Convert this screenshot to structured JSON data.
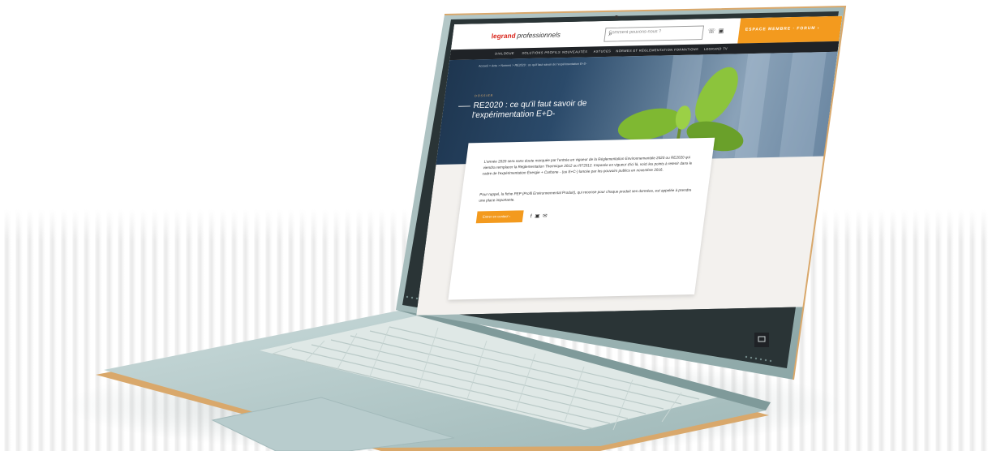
{
  "website": {
    "logo": {
      "brand": "legrand",
      "suffix": "professionnels"
    },
    "search": {
      "placeholder": "Comment pouvons-nous ?"
    },
    "header_icons": [
      "search-icon",
      "phone-icon",
      "user-icon"
    ],
    "cta_label": "ESPACE MEMBRE · FORUM ›",
    "nav": [
      "DIALOGUE",
      "SOLUTIONS PROFILS",
      "NOUVEAUTÉS",
      "ASTUCES",
      "NORMES ET RÉGLEMENTATION",
      "FORMATIONS",
      "LEGRAND TV"
    ],
    "breadcrumb": "Accueil > Actu > Normes > RE2020 : ce qu'il faut savoir de l'expérimentation E+D-",
    "hero": {
      "rubric": "DOSSIER",
      "title": "RE2020 : ce qu'il faut savoir de l'expérimentation E+D-"
    },
    "article": {
      "intro": "L'année 2020 sera sans doute marquée par l'entrée en vigueur de la Réglementation Environnementale 2020 ou RE2020 qui viendra remplacer la Réglementation Thermique 2012 ou RT2012. Imposée en vigueur d'ici là, voici les points à retenir dans le cadre de l'expérimentation Énergie + Carbone - (ou E+C-) lancée par les pouvoirs publics en novembre 2016.",
      "follow": "Pour rappel, la fiche PEP (Profil Environnemental Produit), qui recense pour chaque produit ses données, est appelée à prendre une place importante.",
      "button_label": "Entrer en contact ›",
      "share_icons": [
        "facebook-icon",
        "linkedin-icon",
        "email-icon"
      ]
    }
  },
  "colors": {
    "accent": "#f39a1e",
    "brand_red": "#d9261c",
    "nav_bg": "#1f2226",
    "laptop_body": "#a8bfbf",
    "keyboard": "#eef3f1"
  }
}
